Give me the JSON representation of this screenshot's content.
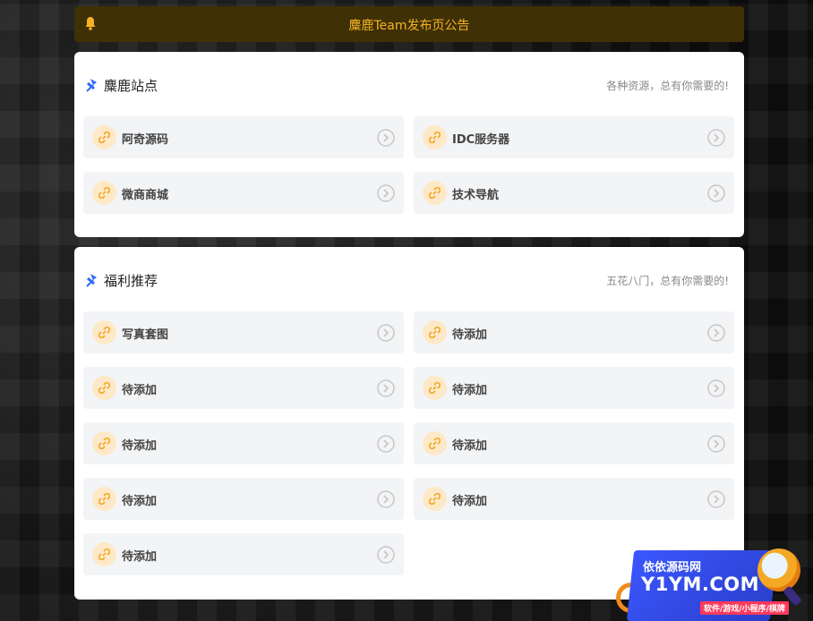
{
  "notice": {
    "text": "麋鹿Team发布页公告"
  },
  "colors": {
    "notice_bg": "#3f3005",
    "notice_text": "#f5b324",
    "accent_blue": "#2f6bff",
    "link_icon": "#f5a623"
  },
  "sections": [
    {
      "title": "麋鹿站点",
      "subtitle": "各种资源，总有你需要的!",
      "items": [
        {
          "label": "阿奇源码"
        },
        {
          "label": "IDC服务器"
        },
        {
          "label": "微商商城"
        },
        {
          "label": "技术导航"
        }
      ]
    },
    {
      "title": "福利推荐",
      "subtitle": "五花八门，总有你需要的!",
      "items": [
        {
          "label": "写真套图"
        },
        {
          "label": "待添加"
        },
        {
          "label": "待添加"
        },
        {
          "label": "待添加"
        },
        {
          "label": "待添加"
        },
        {
          "label": "待添加"
        },
        {
          "label": "待添加"
        },
        {
          "label": "待添加"
        },
        {
          "label": "待添加"
        }
      ]
    }
  ],
  "watermark": {
    "line1": "依依源码网",
    "line2": "Y1YM.COM",
    "line3": "软件/游戏/小程序/棋牌"
  },
  "icons": {
    "notice": "bell-icon",
    "section": "pin-icon",
    "item_left": "link-icon",
    "item_right": "chevron-circle-right-icon"
  }
}
